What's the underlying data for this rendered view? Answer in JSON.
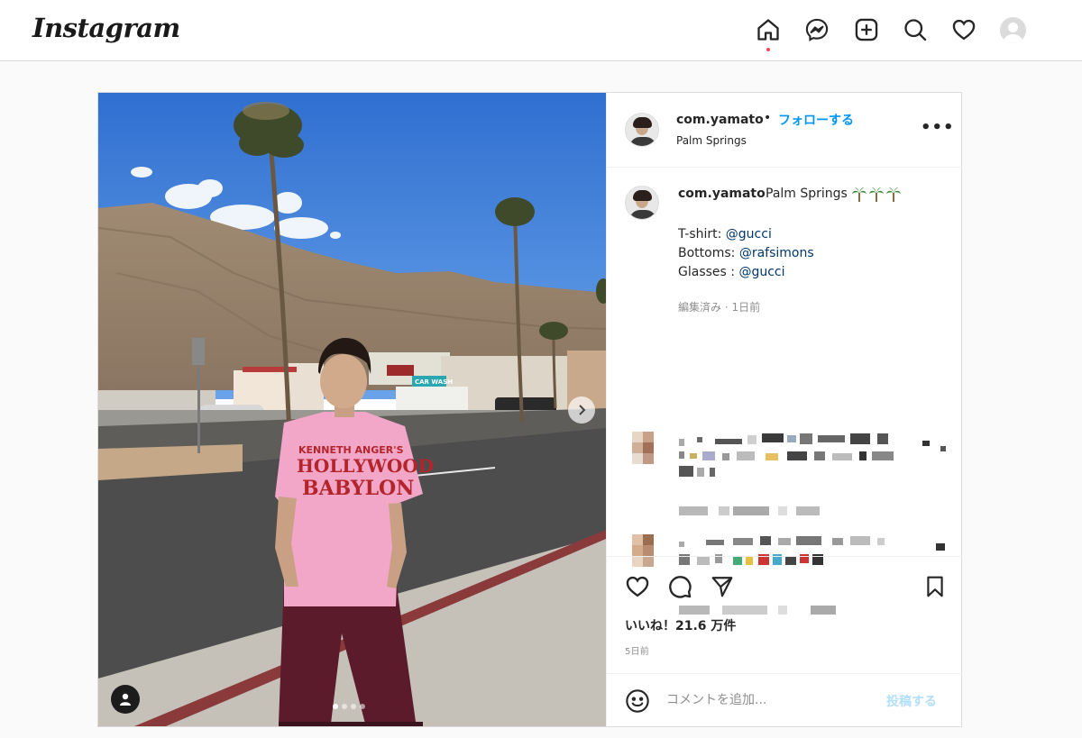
{
  "app": {
    "logo": "Instagram",
    "nav_icons": [
      "home-icon",
      "messenger-icon",
      "new-post-icon",
      "search-icon",
      "heart-icon",
      "profile-avatar"
    ]
  },
  "post": {
    "username": "com.yamato",
    "bullet": "•",
    "follow_label": "フォローする",
    "location": "Palm Springs",
    "more_label": "•••",
    "caption": {
      "username": "com.yamato",
      "text": "Palm Springs",
      "emojis": [
        "palm-tree",
        "palm-tree",
        "palm-tree"
      ],
      "lines": [
        {
          "prefix": "T-shirt: ",
          "mention": "@gucci"
        },
        {
          "prefix": "Bottoms: ",
          "mention": "@rafsimons"
        },
        {
          "prefix": "Glasses : ",
          "mention": "@gucci"
        }
      ],
      "meta": "編集済み · 1日前"
    },
    "likes": "いいね！21.6 万件",
    "time_ago": "5日前",
    "carousel": {
      "total": 4,
      "active": 1
    },
    "shirt_text": [
      "KENNETH ANGER'S",
      "HOLLYWOOD",
      "BABYLON"
    ],
    "sign_text": "CAR WASH"
  },
  "comment_box": {
    "placeholder": "コメントを追加...",
    "post_label": "投稿する"
  },
  "colors": {
    "accent": "#0095f6",
    "post_disabled": "#b2dffc",
    "link": "#00376b",
    "notification": "#ed4956"
  }
}
